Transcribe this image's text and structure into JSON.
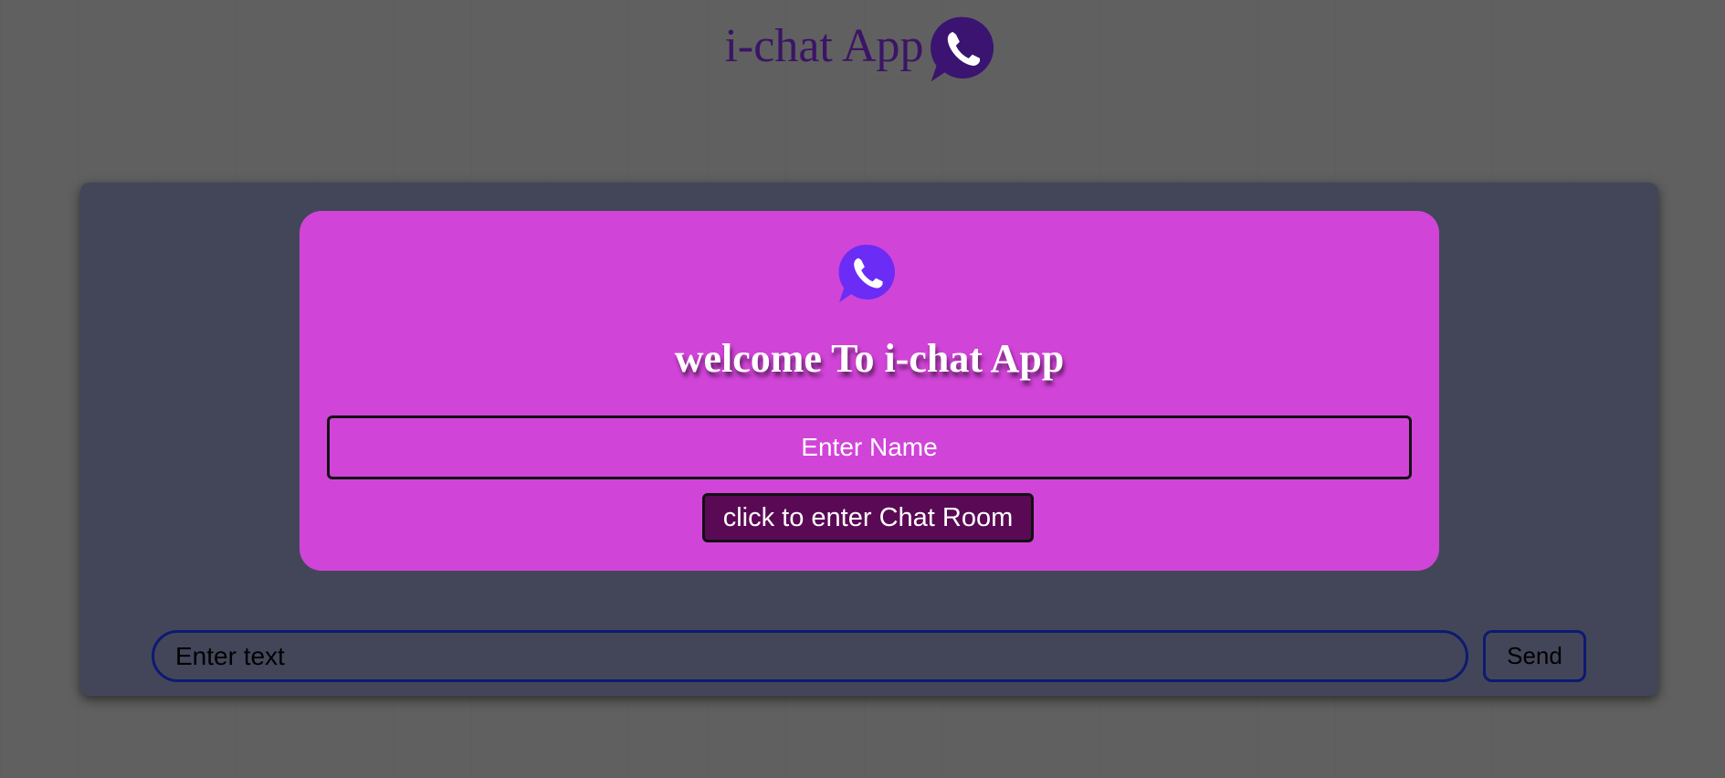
{
  "header": {
    "title": "i-chat App",
    "logo_icon": "whatsapp-phone-icon"
  },
  "modal": {
    "icon": "whatsapp-phone-icon",
    "welcome_text": "welcome To i-chat App",
    "name_input": {
      "value": "",
      "placeholder": "Enter Name"
    },
    "enter_button_label": "click to enter Chat Room"
  },
  "composer": {
    "text_input": {
      "value": "",
      "placeholder": "Enter text"
    },
    "send_label": "Send"
  },
  "colors": {
    "page_background": "#606060",
    "title_color": "#3b1466",
    "panel_background": "#434659",
    "modal_background": "#d144d8",
    "enter_button_background": "#5a0a55",
    "composer_border": "#0d1a70",
    "header_icon_color": "#3a1470",
    "modal_icon_color": "#6b2cf5"
  }
}
